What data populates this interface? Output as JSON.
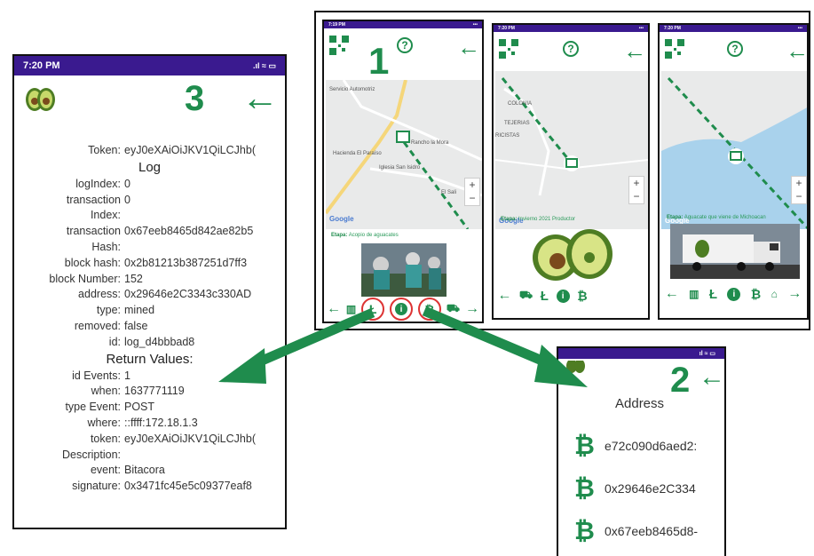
{
  "colors": {
    "accent": "#1f8c4d",
    "statusbar": "#3a1a8f",
    "water": "#a9d2ec",
    "road": "#f5d67a"
  },
  "phone3": {
    "status_time": "7:20 PM",
    "status_icons": ".ıl ≈ ▭",
    "label": "3",
    "back": "←",
    "rows_top": [
      {
        "k": "Token:",
        "v": "eyJ0eXAiOiJKV1QiLCJhb("
      }
    ],
    "log_title": "Log",
    "log_rows": [
      {
        "k": "logIndex:",
        "v": "0"
      },
      {
        "k": "transaction",
        "v": "0"
      },
      {
        "k": "Index:",
        "v": ""
      },
      {
        "k": "transaction",
        "v": "0x67eeb8465d842ae82b5"
      },
      {
        "k": "Hash:",
        "v": ""
      },
      {
        "k": "block hash:",
        "v": "0x2b81213b387251d7ff3"
      },
      {
        "k": "block Number:",
        "v": "152"
      },
      {
        "k": "address:",
        "v": "0x29646e2C3343c330AD"
      },
      {
        "k": "type:",
        "v": "mined"
      },
      {
        "k": "removed:",
        "v": "false"
      },
      {
        "k": "id:",
        "v": "log_d4bbbad8"
      }
    ],
    "return_title": "Return Values:",
    "return_rows": [
      {
        "k": "id Events:",
        "v": "1"
      },
      {
        "k": "when:",
        "v": "1637771119"
      },
      {
        "k": "type Event:",
        "v": "POST"
      },
      {
        "k": "where:",
        "v": "::ffff:172.18.1.3"
      },
      {
        "k": "token:",
        "v": "eyJ0eXAiOiJKV1QiLCJhb("
      },
      {
        "k": "Description:",
        "v": ""
      },
      {
        "k": "event:",
        "v": "Bitacora"
      },
      {
        "k": "signature:",
        "v": "0x3471fc45e5c09377eaf8"
      }
    ]
  },
  "phone1": {
    "status_time": "7:19 PM",
    "label": "1",
    "map_labels": [
      "Servicio Automotriz",
      "Hacienda El Paraíso",
      "Rancho la Mora",
      "Iglesia San Isidro",
      "El Sali"
    ],
    "google": "Google",
    "etapa_key": "Etapa:",
    "etapa_val": "Acopio de aguacates"
  },
  "phone_mid": {
    "status_time": "7:20 PM",
    "map_labels": [
      "COLONIA",
      "TEJERIAS",
      "RICISTAS"
    ],
    "google": "Google",
    "etapa_key": "Etapa:",
    "etapa_val": "Invierno 2021 Productor"
  },
  "phone_right": {
    "status_time": "7:20 PM",
    "google": "Google",
    "etapa_key": "Etapa:",
    "etapa_val": "Aguacate que viene de Michoacan"
  },
  "phone2": {
    "label": "2",
    "back": "←",
    "title": "Address",
    "addresses": [
      "e72c090d6aed2:",
      "0x29646e2C334",
      "0x67eeb8465d8-"
    ],
    "btc_symbol": "₿"
  },
  "icons": {
    "qr": "qr-code-icon",
    "help": "help-icon",
    "back": "back-arrow-icon",
    "truck": "truck-icon",
    "building": "building-icon",
    "litecoin": "Ł",
    "info": "i",
    "bitcoin": "₿",
    "arrow_right": "→",
    "arrow_left": "←"
  }
}
